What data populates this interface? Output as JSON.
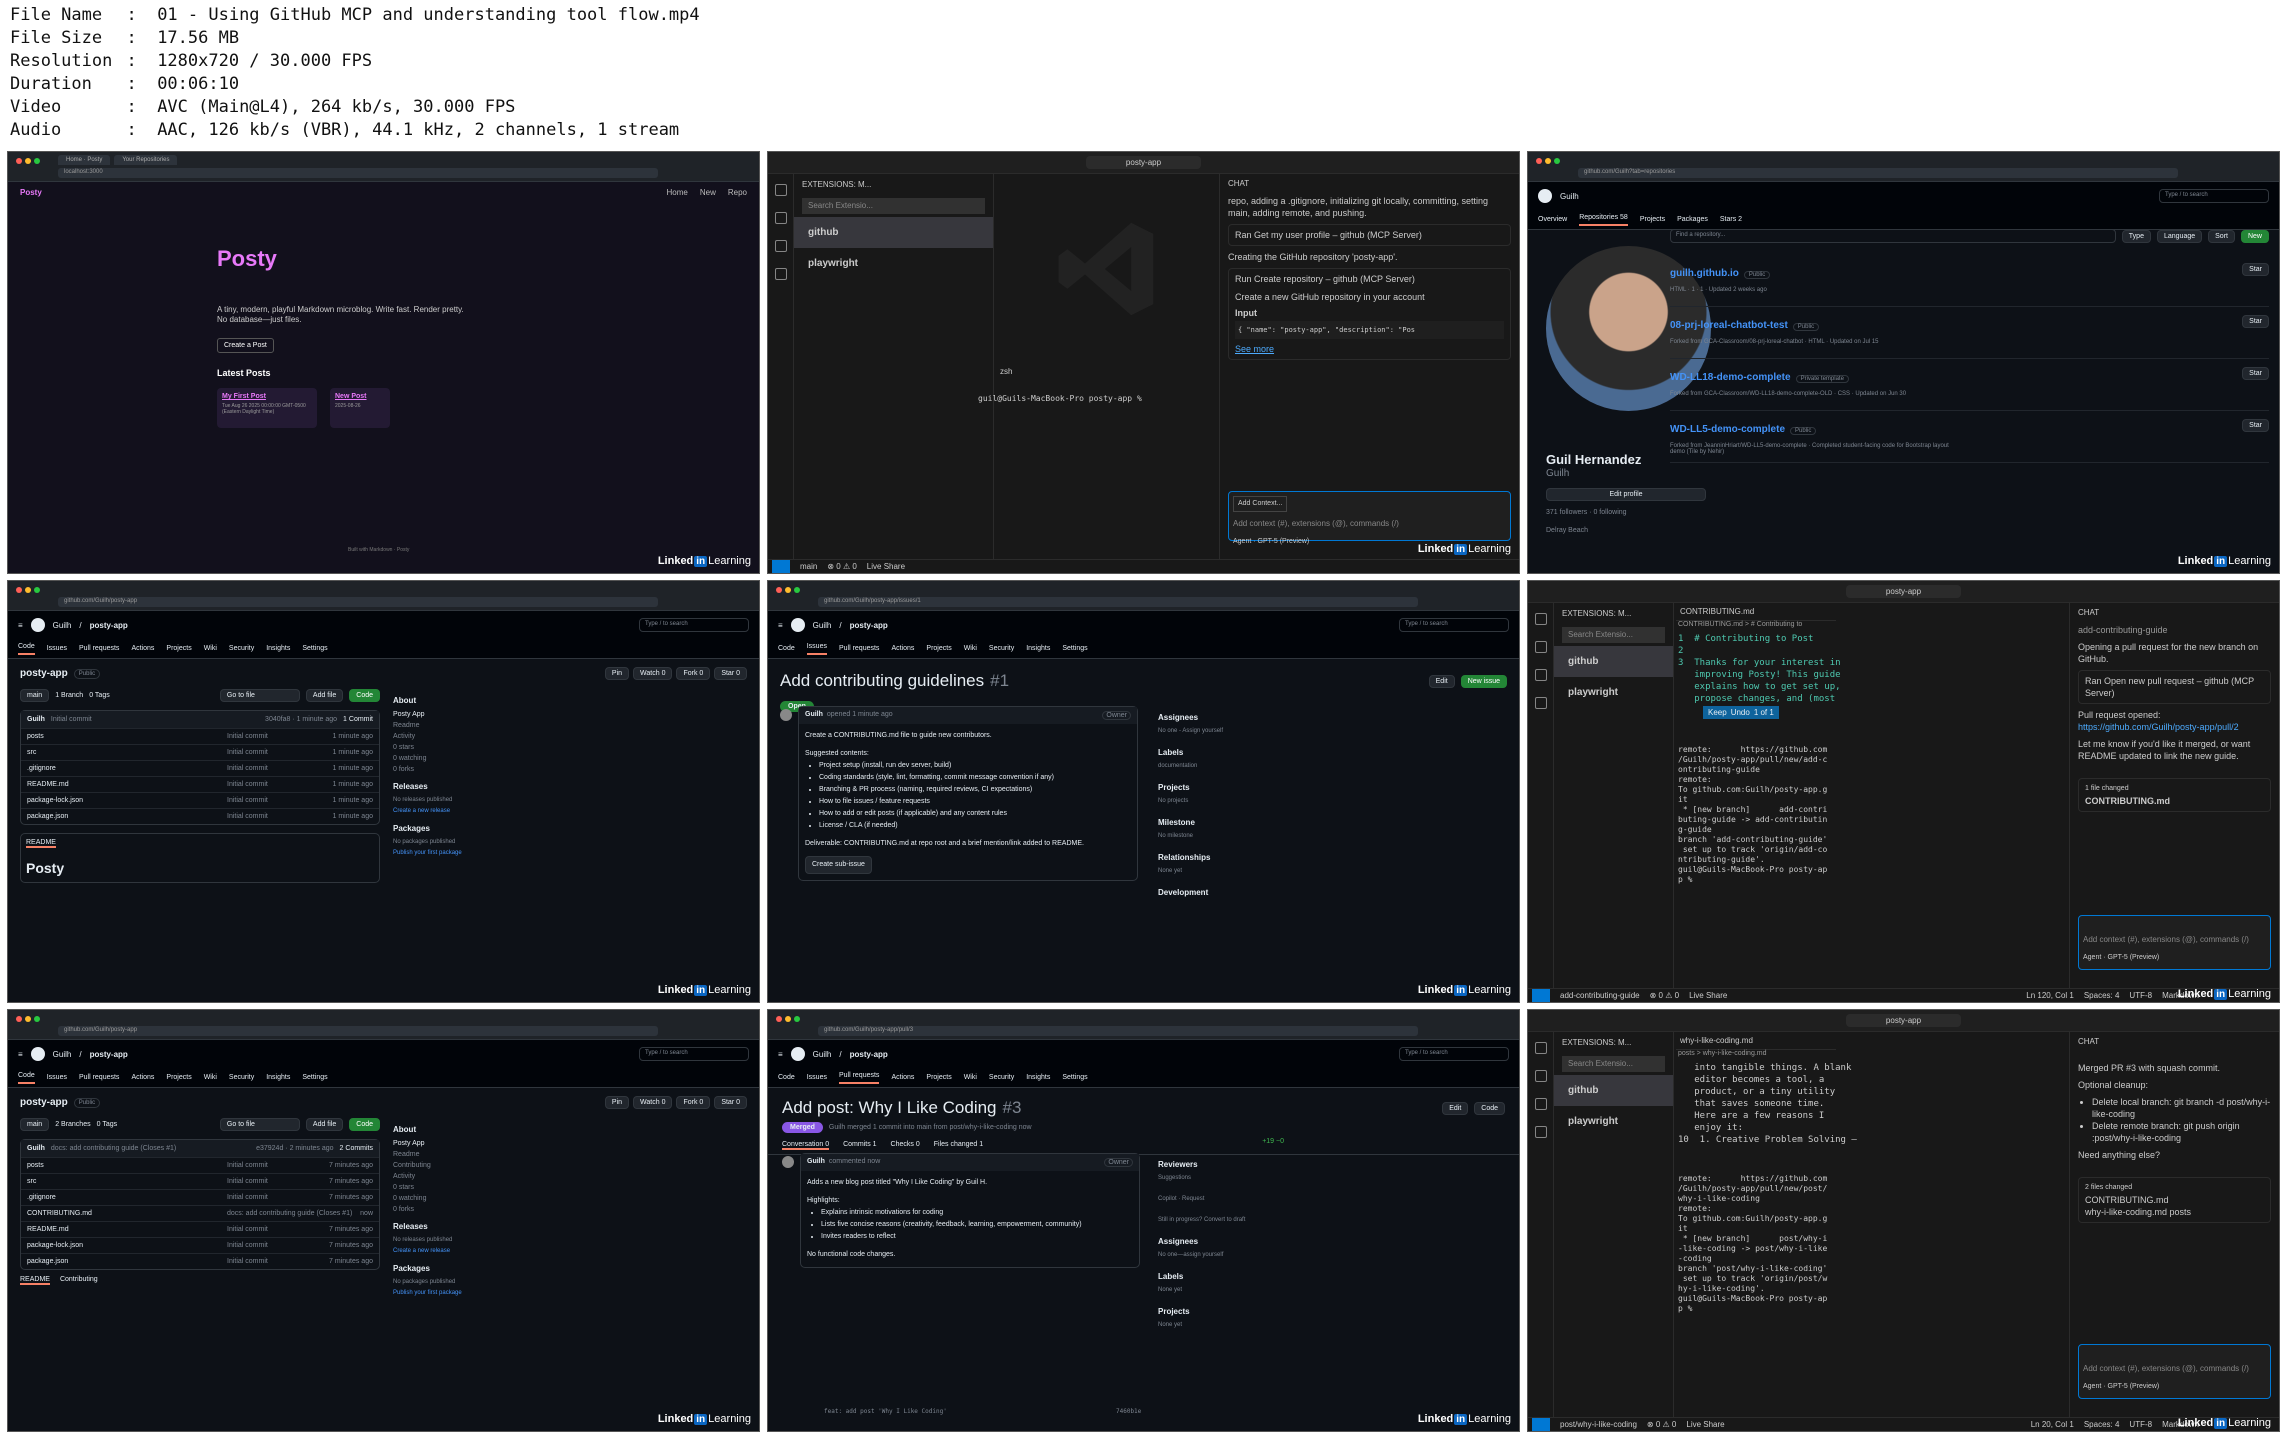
{
  "meta": {
    "rows": [
      {
        "k": "File Name",
        "v": "01 - Using GitHub MCP and understanding tool flow.mp4"
      },
      {
        "k": "File Size",
        "v": "17.56 MB"
      },
      {
        "k": "Resolution",
        "v": "1280x720 / 30.000 FPS"
      },
      {
        "k": "Duration",
        "v": "00:06:10"
      },
      {
        "k": "Video",
        "v": "AVC (Main@L4), 264 kb/s, 30.000 FPS"
      },
      {
        "k": "Audio",
        "v": "AAC, 126 kb/s (VBR), 44.1 kHz, 2 channels, 1 stream"
      }
    ]
  },
  "watermark": {
    "linked": "Linked",
    "in": "in",
    "learning": "Learning"
  },
  "t1": {
    "tab1": "Home · Posty",
    "tab2": "Your Repositories",
    "url": "localhost:3000",
    "brand": "Posty",
    "nav": [
      "Home",
      "New",
      "Repo"
    ],
    "title": "Posty",
    "tagline": "A tiny, modern, playful Markdown microblog. Write fast. Render pretty.",
    "tagline2": "No database—just files.",
    "create": "Create a Post",
    "latest": "Latest Posts",
    "post1": "My First Post",
    "post1date": "Tue Aug 26 2025 00:00:00 GMT-0500 (Eastern Daylight Time)",
    "post2": "New Post",
    "post2date": "2025-08-26",
    "footer": "Built with Markdown · Posty"
  },
  "t2": {
    "search": "posty-app",
    "extHeader": "EXTENSIONS: M...",
    "extSearch": "Search Extensio...",
    "ext1": "github",
    "ext2": "playwright",
    "termTab": "zsh",
    "prompt": "guil@Guils-MacBook-Pro posty-app % ",
    "chatTitle": "CHAT",
    "c1": "repo, adding a .gitignore, initializing git locally, committing, setting main, adding remote, and pushing.",
    "tool1": "Ran Get my user profile – github (MCP Server)",
    "c2": "Creating the GitHub repository 'posty-app'.",
    "tool2": "Run Create repository – github (MCP Server)",
    "c3": "Create a new GitHub repository in your account",
    "inputLabel": "Input",
    "inputJson": "{ \"name\": \"posty-app\", \"description\": \"Pos",
    "seeMore": "See more",
    "addContext": "Add Context...",
    "placeholder": "Add context (#), extensions (@), commands (/)",
    "agent": "Agent",
    "model": "GPT-5 (Preview)",
    "branch": "main",
    "errors": "⊗ 0 ⚠ 0",
    "live": "Live Share"
  },
  "t3": {
    "url": "github.com/Guilh?tab=repositories",
    "user": "Guilh",
    "tabs": [
      "Overview",
      "Repositories 58",
      "Projects",
      "Packages",
      "Stars 2"
    ],
    "name": "Guil Hernandez",
    "login": "Guilh",
    "edit": "Edit profile",
    "followers": "371 followers · 0 following",
    "loc": "Delray Beach",
    "find": "Find a repository...",
    "type": "Type",
    "lang": "Language",
    "sort": "Sort",
    "new": "New",
    "repos": [
      {
        "n": "guilh.github.io",
        "badge": "Public",
        "meta": "HTML · 1 · 1 · Updated 2 weeks ago"
      },
      {
        "n": "08-prj-loreal-chatbot-test",
        "badge": "Public",
        "meta": "Forked from GCA-Classroom/08-prj-loreal-chatbot · HTML · Updated on Jul 15"
      },
      {
        "n": "WD-LL18-demo-complete",
        "badge": "Private template",
        "meta": "Forked from GCA-Classroom/WD-LL18-demo-complete-OLD · CSS · Updated on Jun 30"
      },
      {
        "n": "WD-LL5-demo-complete",
        "badge": "Public",
        "meta": "Forked from JeanninHriart/WD-LL5-demo-complete · Completed student-facing code for Bootstrap layout demo (Tile by Nehir)"
      }
    ],
    "star": "Star"
  },
  "t4": {
    "url": "github.com/Guilh/posty-app",
    "owner": "Guilh",
    "repo": "posty-app",
    "tabs": [
      "Code",
      "Issues",
      "Pull requests",
      "Actions",
      "Projects",
      "Wiki",
      "Security",
      "Insights",
      "Settings"
    ],
    "public": "Public",
    "pin": "Pin",
    "watch": "Watch 0",
    "fork": "Fork 0",
    "starB": "Star 0",
    "branch": "main",
    "branches": "1 Branch",
    "tags": "0 Tags",
    "goto": "Go to file",
    "add": "Add file",
    "code": "Code",
    "commitUser": "Guilh",
    "commitMsg": "Initial commit",
    "commitMeta": "3040fa8 · 1 minute ago",
    "commits": "1 Commit",
    "files": [
      {
        "n": "posts",
        "m": "Initial commit",
        "t": "1 minute ago"
      },
      {
        "n": "src",
        "m": "Initial commit",
        "t": "1 minute ago"
      },
      {
        "n": ".gitignore",
        "m": "Initial commit",
        "t": "1 minute ago"
      },
      {
        "n": "README.md",
        "m": "Initial commit",
        "t": "1 minute ago"
      },
      {
        "n": "package-lock.json",
        "m": "Initial commit",
        "t": "1 minute ago"
      },
      {
        "n": "package.json",
        "m": "Initial commit",
        "t": "1 minute ago"
      }
    ],
    "readme": "README",
    "readmeTitle": "Posty",
    "about": "About",
    "desc": "Posty App",
    "aboutItems": [
      "Readme",
      "Activity",
      "0 stars",
      "0 watching",
      "0 forks"
    ],
    "releases": "Releases",
    "noRel": "No releases published",
    "createRel": "Create a new release",
    "packages": "Packages",
    "noPkg": "No packages published",
    "pubPkg": "Publish your first package"
  },
  "t5": {
    "url": "github.com/Guilh/posty-app/issues/1",
    "title": "Add contributing guidelines",
    "num": "#1",
    "state": "Open",
    "edit": "Edit",
    "newIssue": "New issue",
    "author": "Guilh",
    "opened": "opened 1 minute ago",
    "owner": "Owner",
    "body1": "Create a CONTRIBUTING.md file to guide new contributors.",
    "body2": "Suggested contents:",
    "items": [
      "Project setup (install, run dev server, build)",
      "Coding standards (style, lint, formatting, commit message convention if any)",
      "Branching & PR process (naming, required reviews, CI expectations)",
      "How to file issues / feature requests",
      "How to add or edit posts (if applicable) and any content rules",
      "License / CLA (if needed)"
    ],
    "deliv": "Deliverable: CONTRIBUTING.md at repo root and a brief mention/link added to README.",
    "subissue": "Create sub-issue",
    "side": [
      {
        "h": "Assignees",
        "v": "No one - Assign yourself"
      },
      {
        "h": "Labels",
        "v": "documentation"
      },
      {
        "h": "Projects",
        "v": "No projects"
      },
      {
        "h": "Milestone",
        "v": "No milestone"
      },
      {
        "h": "Relationships",
        "v": "None yet"
      },
      {
        "h": "Development",
        "v": ""
      }
    ]
  },
  "t6": {
    "search": "posty-app",
    "file": "CONTRIBUTING.md",
    "bc": "CONTRIBUTING.md > # Contributing to",
    "code": [
      "1  # Contributing to Post",
      "2",
      "3  Thanks for your interest in",
      "   improving Posty! This guide",
      "   explains how to get set up,",
      "   propose changes, and (most"
    ],
    "keep": "Keep",
    "undo": "Undo",
    "of": "1 of 1",
    "term": "remote:      https://github.com\n/Guilh/posty-app/pull/new/add-c\nontributing-guide\nremote:\nTo github.com:Guilh/posty-app.g\nit\n * [new branch]      add-contri\nbuting-guide -> add-contributin\ng-guide\nbranch 'add-contributing-guide'\n set up to track 'origin/add-co\nntributing-guide'.\nguil@Guils-MacBook-Pro posty-ap\np %",
    "c0": "add-contributing-guide",
    "c1": "Opening a pull request for the new branch on GitHub.",
    "tool": "Ran Open new pull request – github (MCP Server)",
    "c2": "Pull request opened: ",
    "link": "https://github.com/Guilh/posty-app/pull/2",
    "c3": "Let me know if you'd like it merged, or want README updated to link the new guide.",
    "changed": "1 file changed",
    "cfile": "CONTRIBUTING.md",
    "status": "add-contributing-guide",
    "pos": "Ln 120, Col 1",
    "spaces": "Spaces: 4",
    "enc": "UTF-8",
    "lang": "Markdown"
  },
  "t7": {
    "commitMsg": "docs: add contributing guide (Closes #1)",
    "commitMeta": "e37924d · 2 minutes ago",
    "commits": "2 Commits",
    "branches": "2 Branches",
    "tags": "0 Tags",
    "files": [
      {
        "n": "posts",
        "m": "Initial commit",
        "t": "7 minutes ago"
      },
      {
        "n": "src",
        "m": "Initial commit",
        "t": "7 minutes ago"
      },
      {
        "n": ".gitignore",
        "m": "Initial commit",
        "t": "7 minutes ago"
      },
      {
        "n": "CONTRIBUTING.md",
        "m": "docs: add contributing guide (Closes #1)",
        "t": "now"
      },
      {
        "n": "README.md",
        "m": "Initial commit",
        "t": "7 minutes ago"
      },
      {
        "n": "package-lock.json",
        "m": "Initial commit",
        "t": "7 minutes ago"
      },
      {
        "n": "package.json",
        "m": "Initial commit",
        "t": "7 minutes ago"
      }
    ],
    "aboutItems": [
      "Readme",
      "Contributing",
      "Activity",
      "0 stars",
      "0 watching",
      "0 forks"
    ],
    "readmeTabs": [
      "README",
      "Contributing"
    ]
  },
  "t8": {
    "url": "github.com/Guilh/posty-app/pull/3",
    "title": "Add post: Why I Like Coding",
    "num": "#3",
    "state": "Merged",
    "mergeText": "Guilh merged 1 commit into main from post/why-i-like-coding now",
    "edit": "Edit",
    "code": "Code",
    "ptabs": [
      "Conversation 0",
      "Commits 1",
      "Checks 0",
      "Files changed 1"
    ],
    "diff": "+19 −0",
    "author": "Guilh",
    "commented": "commented now",
    "owner": "Owner",
    "b1": "Adds a new blog post titled \"Why I Like Coding\" by Guil H.",
    "b2": "Highlights:",
    "items": [
      "Explains intrinsic motivations for coding",
      "Lists five concise reasons (creativity, feedback, learning, empowerment, community)",
      "Invites readers to reflect"
    ],
    "b3": "No functional code changes.",
    "commit": "feat: add post 'Why I Like Coding'",
    "sha": "7460b1e",
    "side": [
      {
        "h": "Reviewers",
        "v": "Suggestions"
      },
      {
        "h": "",
        "v": "Copilot · Request"
      },
      {
        "h": "",
        "v": "Still in progress? Convert to draft"
      },
      {
        "h": "Assignees",
        "v": "No one—assign yourself"
      },
      {
        "h": "Labels",
        "v": "None yet"
      },
      {
        "h": "Projects",
        "v": "None yet"
      }
    ]
  },
  "t9": {
    "file": "why-i-like-coding.md",
    "bc": "posts > why-i-like-coding.md",
    "code": [
      "   into tangible things. A blank",
      "   editor becomes a tool, a",
      "   product, or a tiny utility",
      "   that saves someone time.",
      "",
      "   Here are a few reasons I",
      "   enjoy it:",
      "",
      "10  1. Creative Problem Solving —"
    ],
    "term": "remote:      https://github.com\n/Guilh/posty-app/pull/new/post/\nwhy-i-like-coding\nremote:\nTo github.com:Guilh/posty-app.g\nit\n * [new branch]      post/why-i\n-like-coding -> post/why-i-like\n-coding\nbranch 'post/why-i-like-coding'\n set up to track 'origin/post/w\nhy-i-like-coding'.\nguil@Guils-MacBook-Pro posty-ap\np %",
    "c1": "Merged PR #3 with squash commit.",
    "c2": "Optional cleanup:",
    "items": [
      "Delete local branch: git branch -d post/why-i-like-coding",
      "Delete remote branch: git push origin :post/why-i-like-coding"
    ],
    "c3": "Need anything else?",
    "changed": "2 files changed",
    "f1": "CONTRIBUTING.md",
    "f2": "why-i-like-coding.md posts",
    "status": "post/why-i-like-coding",
    "pos": "Ln 20, Col 1"
  }
}
